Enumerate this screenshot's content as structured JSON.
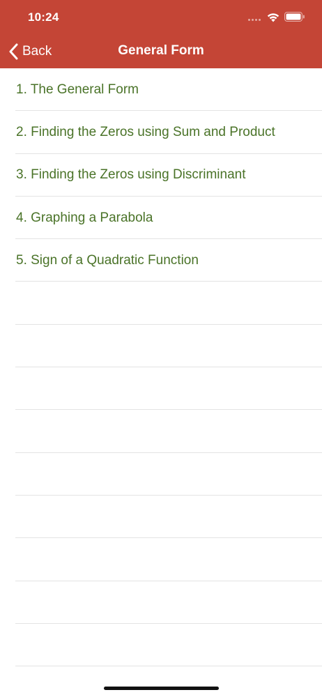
{
  "status_bar": {
    "time": "10:24"
  },
  "nav": {
    "back_label": "Back",
    "title": "General Form"
  },
  "list": {
    "items": [
      {
        "label": "1. The General Form"
      },
      {
        "label": "2. Finding the Zeros using Sum and Product"
      },
      {
        "label": "3. Finding the Zeros using Discriminant"
      },
      {
        "label": "4. Graphing a Parabola"
      },
      {
        "label": "5. Sign of a Quadratic Function"
      }
    ]
  },
  "colors": {
    "nav_bar": "#c44536",
    "item_text": "#4a7328",
    "separator": "#e3e3e3"
  },
  "icons": [
    "wifi-icon",
    "battery-icon",
    "chevron-left-icon"
  ]
}
